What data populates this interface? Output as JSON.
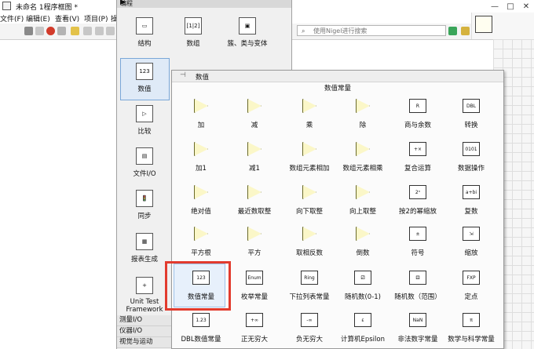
{
  "window": {
    "title": "未命名 1程序框图 *",
    "menu": [
      "文件(F)",
      "编辑(E)",
      "查看(V)",
      "项目(P)",
      "操"
    ],
    "search_placeholder": "使用Nigel进行搜索"
  },
  "palette": {
    "header": "编程",
    "items": [
      {
        "label": "结构",
        "icon": "structures-icon",
        "glyph": "▭"
      },
      {
        "label": "数组",
        "icon": "array-icon",
        "glyph": "[1|2]"
      },
      {
        "label": "簇、类与变体",
        "icon": "cluster-icon",
        "glyph": "▣"
      },
      {
        "label": "数值",
        "icon": "numeric-icon",
        "glyph": "123"
      },
      {
        "label": "比较",
        "icon": "comparison-icon",
        "glyph": "▷"
      },
      {
        "label": "文件I/O",
        "icon": "file-io-icon",
        "glyph": "▤"
      },
      {
        "label": "同步",
        "icon": "synchronization-icon",
        "glyph": "🚦"
      },
      {
        "label": "报表生成",
        "icon": "report-generation-icon",
        "glyph": "▦"
      },
      {
        "label": "Unit Test\nFramework",
        "icon": "unit-test-icon",
        "glyph": "+"
      }
    ],
    "bottom_categories": [
      "测量I/O",
      "仪器I/O",
      "视觉与运动"
    ]
  },
  "numeric": {
    "header": "数值",
    "caption": "数值常量",
    "items": [
      {
        "label": "加",
        "icon": "add-icon",
        "glyph": "+"
      },
      {
        "label": "减",
        "icon": "subtract-icon",
        "glyph": "−"
      },
      {
        "label": "乘",
        "icon": "multiply-icon",
        "glyph": "×"
      },
      {
        "label": "除",
        "icon": "divide-icon",
        "glyph": "÷"
      },
      {
        "label": "商与余数",
        "icon": "quotient-remainder-icon",
        "glyph": "R"
      },
      {
        "label": "转换",
        "icon": "conversion-icon",
        "glyph": "DBL"
      },
      {
        "label": "加1",
        "icon": "increment-icon",
        "glyph": "+1"
      },
      {
        "label": "减1",
        "icon": "decrement-icon",
        "glyph": "-1"
      },
      {
        "label": "数组元素相加",
        "icon": "add-array-elements-icon",
        "glyph": "Σ"
      },
      {
        "label": "数组元素相乘",
        "icon": "multiply-array-elements-icon",
        "glyph": "Π"
      },
      {
        "label": "复合运算",
        "icon": "compound-arithmetic-icon",
        "glyph": "+×"
      },
      {
        "label": "数据操作",
        "icon": "data-manipulation-icon",
        "glyph": "0101"
      },
      {
        "label": "绝对值",
        "icon": "absolute-value-icon",
        "glyph": "|x|"
      },
      {
        "label": "最近数取整",
        "icon": "round-nearest-icon",
        "glyph": "[ ]"
      },
      {
        "label": "向下取整",
        "icon": "round-down-icon",
        "glyph": "⌊⌋"
      },
      {
        "label": "向上取整",
        "icon": "round-up-icon",
        "glyph": "⌈⌉"
      },
      {
        "label": "按2的幂缩放",
        "icon": "scale-power-of-2-icon",
        "glyph": "2ⁿ"
      },
      {
        "label": "复数",
        "icon": "complex-icon",
        "glyph": "a+bi"
      },
      {
        "label": "平方根",
        "icon": "square-root-icon",
        "glyph": "√"
      },
      {
        "label": "平方",
        "icon": "square-icon",
        "glyph": "x²"
      },
      {
        "label": "取相反数",
        "icon": "negate-icon",
        "glyph": "−x"
      },
      {
        "label": "倒数",
        "icon": "reciprocal-icon",
        "glyph": "1/x"
      },
      {
        "label": "符号",
        "icon": "sign-icon",
        "glyph": "±"
      },
      {
        "label": "缩放",
        "icon": "scaling-icon",
        "glyph": "⇲"
      },
      {
        "label": "数值常量",
        "icon": "numeric-constant-icon",
        "glyph": "123"
      },
      {
        "label": "枚举常量",
        "icon": "enum-constant-icon",
        "glyph": "Enum"
      },
      {
        "label": "下拉列表常量",
        "icon": "ring-constant-icon",
        "glyph": "Ring"
      },
      {
        "label": "随机数(0-1)",
        "icon": "random-number-icon",
        "glyph": "⚂"
      },
      {
        "label": "随机数（范围）",
        "icon": "random-range-icon",
        "glyph": "⚃"
      },
      {
        "label": "定点",
        "icon": "fixed-point-icon",
        "glyph": "FXP"
      },
      {
        "label": "DBL数值常量",
        "icon": "dbl-constant-icon",
        "glyph": "1.23"
      },
      {
        "label": "正无穷大",
        "icon": "positive-infinity-icon",
        "glyph": "+∞"
      },
      {
        "label": "负无穷大",
        "icon": "negative-infinity-icon",
        "glyph": "-∞"
      },
      {
        "label": "计算机Epsilon",
        "icon": "machine-epsilon-icon",
        "glyph": "ε"
      },
      {
        "label": "非法数字常量",
        "icon": "nan-constant-icon",
        "glyph": "NaN"
      },
      {
        "label": "数学与科学常量",
        "icon": "math-constants-icon",
        "glyph": "π"
      }
    ]
  },
  "colors": {
    "highlight": "#e23b2e",
    "selection": "#dfeaf7"
  }
}
